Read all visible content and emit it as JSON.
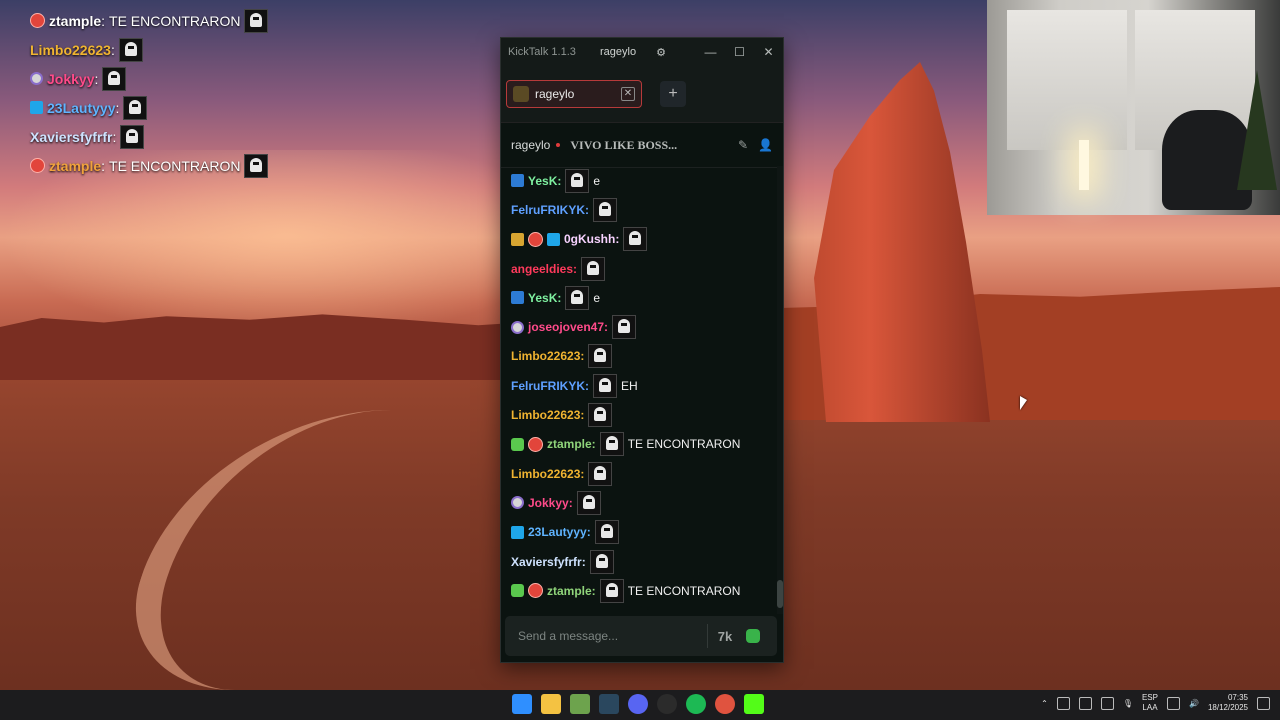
{
  "overlay_chat": [
    {
      "badges": [
        "red"
      ],
      "user": "ztample",
      "color": "#ffffff",
      "sep": ":",
      "text": "TE ENCONTRARON",
      "emote": true
    },
    {
      "badges": [],
      "user": "Limbo22623",
      "color": "#f0b431",
      "sep": ":",
      "text": "",
      "emote": true
    },
    {
      "badges": [
        "gray"
      ],
      "user": "Jokkyy",
      "color": "#ff4b8a",
      "sep": ":",
      "text": "",
      "emote": true
    },
    {
      "badges": [
        "cube"
      ],
      "user": "23Lautyyy",
      "color": "#5fb4ff",
      "sep": ":",
      "text": "",
      "emote": true
    },
    {
      "badges": [],
      "user": "Xaviersfyfrfr",
      "color": "#cfe3ff",
      "sep": ":",
      "text": "",
      "emote": true
    },
    {
      "badges": [
        "red"
      ],
      "user": "ztample",
      "color": "#f0a23c",
      "sep": ":",
      "text": "TE ENCONTRARON",
      "emote": true
    }
  ],
  "window": {
    "app_title": "KickTalk 1.1.3",
    "user": "rageylo",
    "minimize": "—",
    "maximize": "☐",
    "close": "✕"
  },
  "tabs": {
    "active_tab": "rageylo",
    "close": "✕",
    "add": "+"
  },
  "channel": {
    "name": "rageylo",
    "stream_title": "VIVO LIKE BOSS..."
  },
  "chat": [
    {
      "badges": [
        "bolt"
      ],
      "user": "YesK",
      "color": "#7ef0a0",
      "text": "e"
    },
    {
      "badges": [],
      "user": "FelruFRIKYK",
      "color": "#5fa0ff",
      "text": ""
    },
    {
      "badges": [
        "gold",
        "red",
        "cube"
      ],
      "user": "0gKushh",
      "color": "#f7d2ff",
      "text": ""
    },
    {
      "badges": [],
      "user": "angeeldies",
      "color": "#ff3a5c",
      "text": ""
    },
    {
      "badges": [
        "bolt"
      ],
      "user": "YesK",
      "color": "#7ef0a0",
      "text": "e"
    },
    {
      "badges": [
        "gray"
      ],
      "user": "joseojoven47",
      "color": "#ff4b8a",
      "text": ""
    },
    {
      "badges": [],
      "user": "Limbo22623",
      "color": "#f0b431",
      "text": ""
    },
    {
      "badges": [],
      "user": "FelruFRIKYK",
      "color": "#5fa0ff",
      "text": "EH"
    },
    {
      "badges": [],
      "user": "Limbo22623",
      "color": "#f0b431",
      "text": ""
    },
    {
      "badges": [
        "green",
        "red"
      ],
      "user": "ztample",
      "color": "#8fd47a",
      "text": "TE ENCONTRARON"
    },
    {
      "badges": [],
      "user": "Limbo22623",
      "color": "#f0b431",
      "text": ""
    },
    {
      "badges": [
        "gray"
      ],
      "user": "Jokkyy",
      "color": "#ff4b8a",
      "text": ""
    },
    {
      "badges": [
        "cube"
      ],
      "user": "23Lautyyy",
      "color": "#5fb4ff",
      "text": ""
    },
    {
      "badges": [],
      "user": "Xaviersfyfrfr",
      "color": "#cfe3ff",
      "text": ""
    },
    {
      "badges": [
        "green",
        "red"
      ],
      "user": "ztample",
      "color": "#8fd47a",
      "text": "TE ENCONTRARON"
    }
  ],
  "input": {
    "placeholder": "Send a message...",
    "kick_emote_label": "7k"
  },
  "taskbar": {
    "apps": [
      "windows-start",
      "file-explorer",
      "minecraft",
      "steam",
      "discord",
      "chatgpt",
      "spotify",
      "chrome",
      "kick"
    ],
    "lang_top": "ESP",
    "lang_bottom": "LAA",
    "time": "07:35",
    "date": "18/12/2025"
  },
  "colors": {
    "accent_red": "#b63a3a",
    "kick_green": "#39b34a",
    "chat_bg": "#0b1310"
  }
}
